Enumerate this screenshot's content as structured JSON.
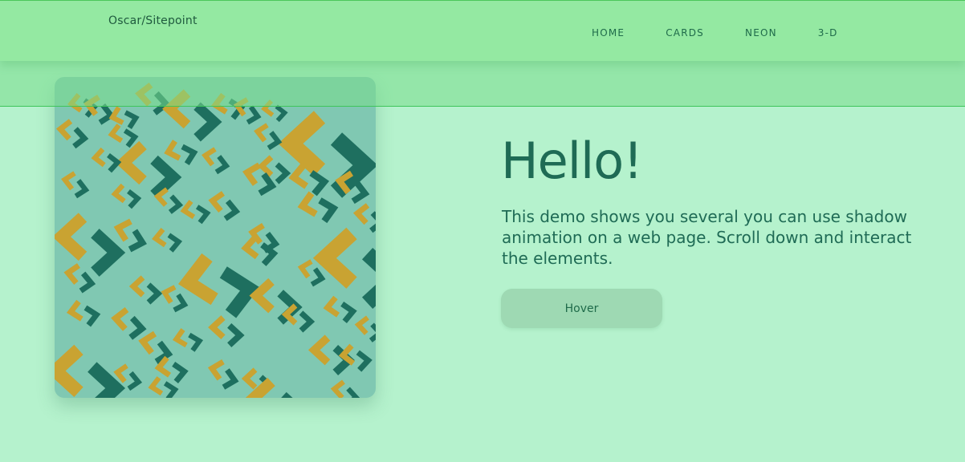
{
  "header": {
    "brand": "Oscar/Sitepoint",
    "nav": [
      {
        "label": "HOME"
      },
      {
        "label": "CARDS"
      },
      {
        "label": "NEON"
      },
      {
        "label": "3-D"
      }
    ]
  },
  "hero": {
    "title": "Hello!",
    "description": "This demo shows you several you can use shadow animation on a web page. Scroll down and interact the elements.",
    "button_label": "Hover"
  },
  "colors": {
    "page_bg": "#b5f2cd",
    "navbar_bg": "#94e9a2",
    "card_bg": "#80c8b2",
    "chevron_gold": "#c9a332",
    "chevron_teal": "#1e6f5f",
    "text_primary": "#1f6b55"
  }
}
